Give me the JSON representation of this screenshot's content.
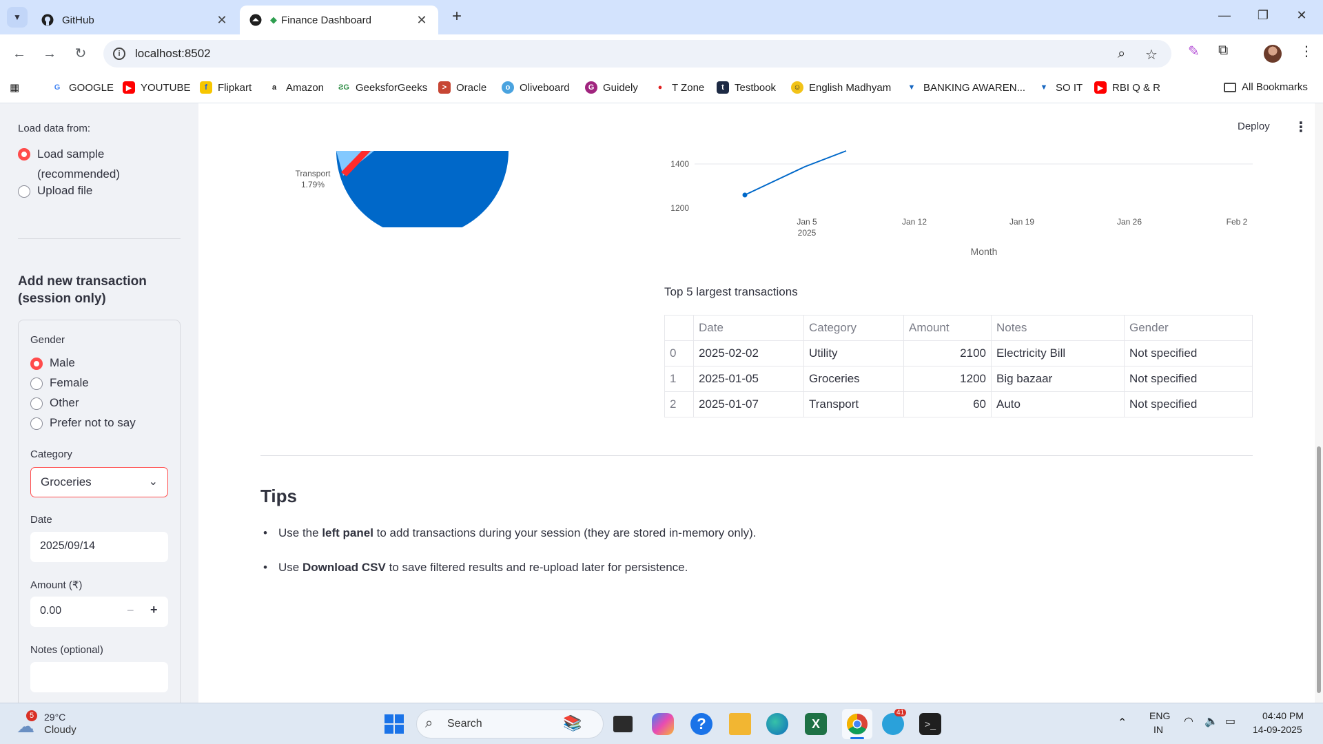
{
  "browser": {
    "tabs": [
      {
        "title": "GitHub",
        "active": false
      },
      {
        "title": "Finance Dashboard",
        "active": true
      }
    ],
    "url": "localhost:8502",
    "bookmarks": [
      "GOOGLE",
      "YOUTUBE",
      "Flipkart",
      "Amazon",
      "GeeksforGeeks",
      "Oracle",
      "Oliveboard",
      "Guidely",
      "T Zone",
      "Testbook",
      "English Madhyam",
      "BANKING AWAREN...",
      "SO IT",
      "RBI Q & R"
    ],
    "all_bookmarks": "All Bookmarks"
  },
  "app": {
    "deploy_label": "Deploy",
    "sidebar": {
      "load_label": "Load data from:",
      "load_options": [
        "Load sample (recommended)",
        "Upload file"
      ],
      "add_heading": "Add new transaction (session only)",
      "gender_label": "Gender",
      "gender_options": [
        "Male",
        "Female",
        "Other",
        "Prefer not to say"
      ],
      "category_label": "Category",
      "category_value": "Groceries",
      "date_label": "Date",
      "date_value": "2025/09/14",
      "amount_label": "Amount (₹)",
      "amount_value": "0.00",
      "notes_label": "Notes (optional)",
      "notes_value": ""
    },
    "pie": {
      "label_name": "Transport",
      "label_pct": "1.79%"
    },
    "line_chart": {
      "y_ticks": [
        "1400",
        "1200"
      ],
      "x_ticks": [
        "Jan 5",
        "Jan 12",
        "Jan 19",
        "Jan 26",
        "Feb 2"
      ],
      "x_year": "2025",
      "xlabel": "Month"
    },
    "top5": {
      "title": "Top 5 largest transactions",
      "columns": [
        "",
        "Date",
        "Category",
        "Amount",
        "Notes",
        "Gender"
      ],
      "rows": [
        [
          "0",
          "2025-02-02",
          "Utility",
          "2100",
          "Electricity Bill",
          "Not specified"
        ],
        [
          "1",
          "2025-01-05",
          "Groceries",
          "1200",
          "Big bazaar",
          "Not specified"
        ],
        [
          "2",
          "2025-01-07",
          "Transport",
          "60",
          "Auto",
          "Not specified"
        ]
      ]
    },
    "tips": {
      "title": "Tips",
      "tip1_pre": "Use the ",
      "tip1_bold": "left panel",
      "tip1_post": " to add transactions during your session (they are stored in-memory only).",
      "tip2_pre": "Use ",
      "tip2_bold": "Download CSV",
      "tip2_post": " to save filtered results and re-upload later for persistence."
    }
  },
  "taskbar": {
    "weather_temp": "29°C",
    "weather_desc": "Cloudy",
    "weather_badge": "5",
    "search_placeholder": "Search",
    "telegram_badge": "41",
    "lang1": "ENG",
    "lang2": "IN",
    "time": "04:40 PM",
    "date": "14-09-2025"
  }
}
